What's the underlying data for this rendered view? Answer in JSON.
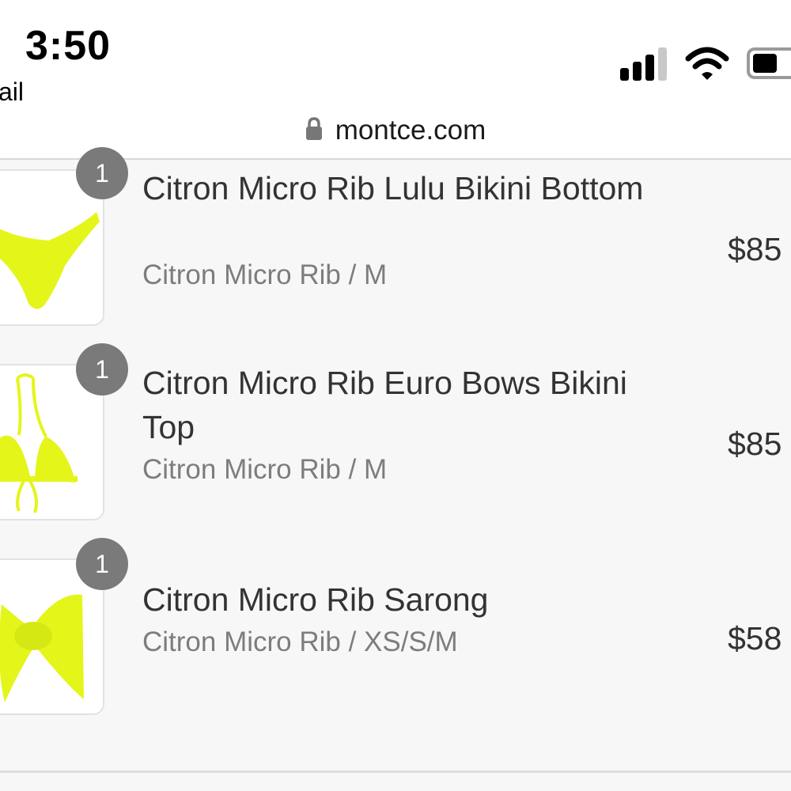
{
  "status_bar": {
    "time": "3:50",
    "back_app": "ail",
    "battery_level": 0.25
  },
  "browser": {
    "url": "montce.com"
  },
  "cart": {
    "items": [
      {
        "quantity": "1",
        "name": "Citron Micro Rib Lulu Bikini Bottom",
        "variant": "Citron Micro Rib / M",
        "price": "$85"
      },
      {
        "quantity": "1",
        "name": "Citron Micro Rib Euro Bows Bikini Top",
        "variant": "Citron Micro Rib / M",
        "price": "$85"
      },
      {
        "quantity": "1",
        "name": "Citron Micro Rib Sarong",
        "variant": "Citron Micro Rib / XS/S/M",
        "price": "$58"
      }
    ]
  },
  "colors": {
    "product_yellow": "#e4f51a",
    "badge_gray": "#7a7a7a",
    "variant_gray": "#7d7d7d"
  },
  "icons": [
    "lock-icon",
    "signal-icon",
    "wifi-icon",
    "battery-icon"
  ]
}
